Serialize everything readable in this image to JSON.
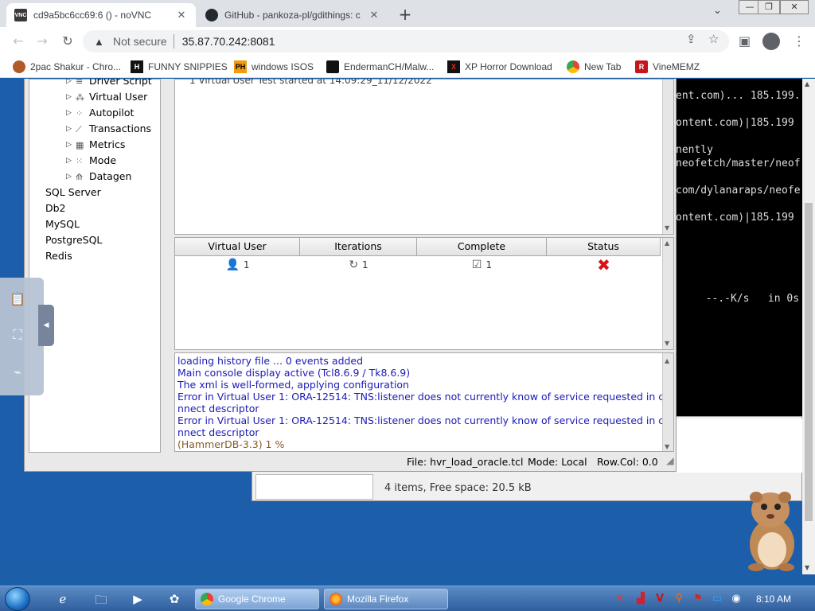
{
  "browser": {
    "tabs": [
      {
        "title": "cd9a5bc6cc69:6 () - noVNC",
        "favicon": "VNC",
        "active": true
      },
      {
        "title": "GitHub - pankoza-pl/gdithings: c",
        "favicon": "github-icon",
        "active": false
      }
    ],
    "window_controls": {
      "minimize": "—",
      "restore": "❐",
      "close": "✕"
    },
    "address": {
      "security_label": "Not secure",
      "url": "35.87.70.242:8081"
    },
    "bookmarks": [
      {
        "label": "2pac Shakur - Chro...",
        "icon": "2pac-icon"
      },
      {
        "label": "FUNNY SNIPPIES",
        "icon": "H"
      },
      {
        "label": "windows ISOS",
        "icon": "PH"
      },
      {
        "label": "EndermanCH/Malw...",
        "icon": "github-icon"
      },
      {
        "label": "XP Horror Download",
        "icon": "X"
      },
      {
        "label": "New Tab",
        "icon": "newtab-icon"
      },
      {
        "label": "VineMEMZ",
        "icon": "R"
      }
    ]
  },
  "hammerdb": {
    "tree": {
      "children": [
        {
          "label": "Driver Script",
          "icon": "script-icon"
        },
        {
          "label": "Virtual User",
          "icon": "users-icon"
        },
        {
          "label": "Autopilot",
          "icon": "autopilot-icon"
        },
        {
          "label": "Transactions",
          "icon": "chart-icon"
        },
        {
          "label": "Metrics",
          "icon": "metrics-icon"
        },
        {
          "label": "Mode",
          "icon": "mode-icon"
        },
        {
          "label": "Datagen",
          "icon": "datagen-icon"
        }
      ],
      "roots": [
        "SQL Server",
        "Db2",
        "MySQL",
        "PostgreSQL",
        "Redis"
      ]
    },
    "output_line": "1 Virtual User Test started at 14:09:29_11/12/2022",
    "vu_table": {
      "headers": [
        "Virtual User",
        "Iterations",
        "Complete",
        "Status"
      ],
      "row": {
        "virtual_user": "1",
        "iterations": "1",
        "complete": "1",
        "status": "✖"
      }
    },
    "console": [
      "loading history file ... 0 events added",
      "Main console display active (Tcl8.6.9 / Tk8.6.9)",
      "The xml is well-formed, applying configuration",
      "Error in Virtual User 1: ORA-12514: TNS:listener does not currently know of service requested in co",
      "nnect descriptor",
      "Error in Virtual User 1: ORA-12514: TNS:listener does not currently know of service requested in co",
      "nnect descriptor",
      "(HammerDB-3.3) 1 %"
    ],
    "status": {
      "file": "File: hvr_load_oracle.tcl",
      "mode": "Mode: Local",
      "rowcol": "Row.Col:  0.0"
    }
  },
  "terminal": [
    "ent.com)... 185.199.",
    "ontent.com)|185.199",
    "nently",
    "neofetch/master/neof",
    "com/dylanaraps/neofe",
    "ontent.com)|185.199",
    "  --.-K/s   in 0s"
  ],
  "explorer": {
    "status": "4 items, Free space: 20.5 kB"
  },
  "taskbar": {
    "tasks": [
      {
        "label": "Google Chrome",
        "active": true
      },
      {
        "label": "Mozilla Firefox",
        "active": false
      }
    ],
    "clock": "8:10 AM"
  }
}
